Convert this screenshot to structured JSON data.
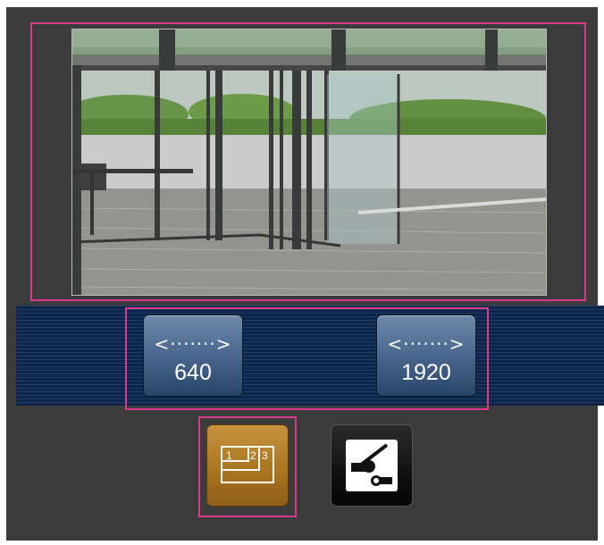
{
  "resolution_buttons": [
    {
      "label": "640",
      "arrow": "<·······>"
    },
    {
      "label": "1920",
      "arrow": "<·······>"
    }
  ],
  "multi_screen_button": {
    "label_1": "1",
    "label_2": "2",
    "label_3": "3",
    "icon": "multi-screen-icon",
    "state": "selected"
  },
  "setup_button": {
    "icon": "setup-slider-icon"
  },
  "colors": {
    "panel_bg": "#3b3b3b",
    "highlight": "#d93a8a",
    "strip_bg": "#0e2448",
    "button_blue": "#4d6a90",
    "button_gold": "#a8731f"
  }
}
